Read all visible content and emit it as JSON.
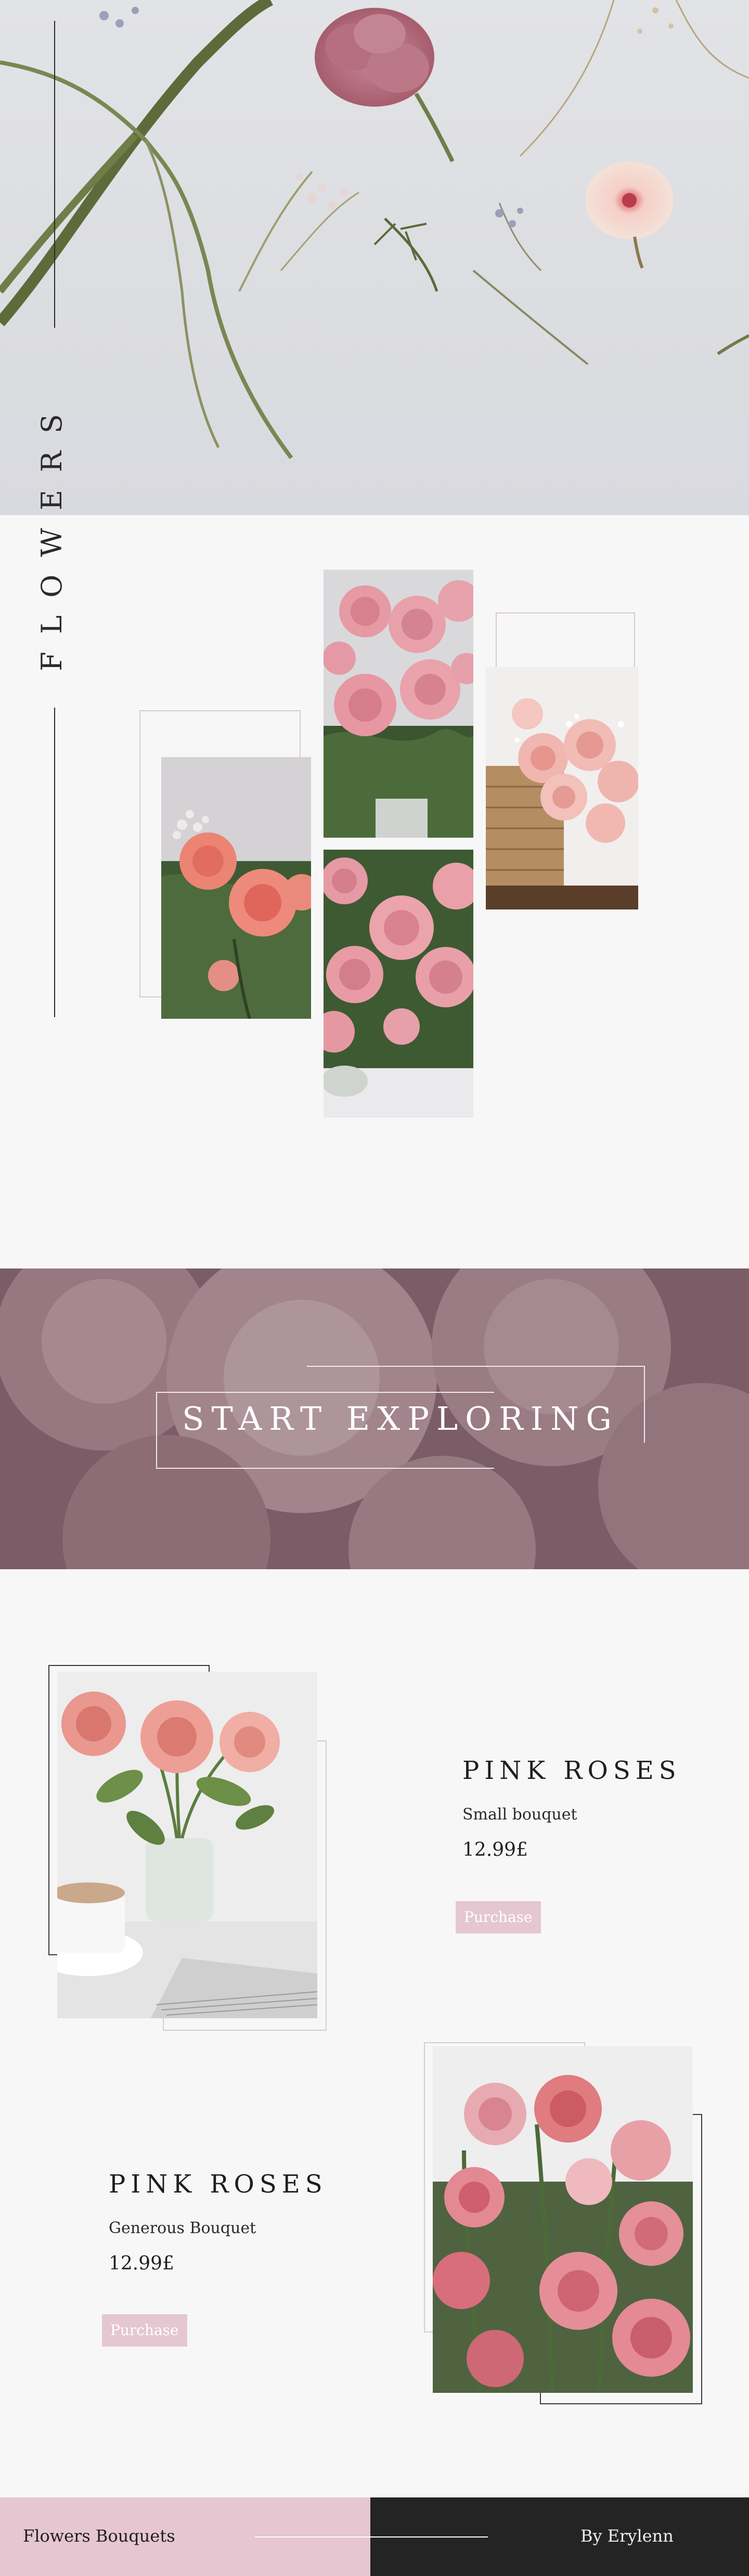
{
  "hero": {
    "vertical_title": "FLOWERS",
    "image": "flat-lay-flowers-photo"
  },
  "gallery": {
    "images": [
      {
        "name": "roses-bouquet-photo-1",
        "subject": "pink and coral roses with baby's breath"
      },
      {
        "name": "roses-bouquet-photo-2",
        "subject": "pink garden roses"
      },
      {
        "name": "roses-bouquet-photo-3",
        "subject": "pink roses close-up"
      },
      {
        "name": "roses-bouquet-photo-4",
        "subject": "roses in wicker basket"
      }
    ]
  },
  "banner": {
    "title": "START EXPLORING"
  },
  "products": [
    {
      "name": "PINK ROSES",
      "description": "Small bouquet",
      "price": "12.99£",
      "button_label": "Purchase"
    },
    {
      "name": "PINK ROSES",
      "description": "Generous Bouquet",
      "price": "12.99£",
      "button_label": "Purchase"
    }
  ],
  "footer": {
    "brand": "Flowers Bouquets",
    "author": "By Erylenn"
  },
  "colors": {
    "accent_pink": "#e5c7d1",
    "footer_dark": "#242424",
    "background": "#f7f7f8"
  }
}
